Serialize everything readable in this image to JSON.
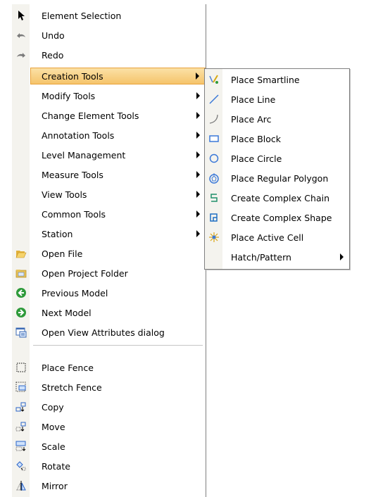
{
  "main_menu": {
    "items": [
      {
        "label": "Element Selection",
        "icon": "arrow-cursor-icon"
      },
      {
        "label": "Undo",
        "icon": "undo-icon"
      },
      {
        "label": "Redo",
        "icon": "redo-icon"
      },
      {
        "label": "Creation Tools",
        "submenu": true,
        "highlighted": true
      },
      {
        "label": "Modify Tools",
        "submenu": true
      },
      {
        "label": "Change Element Tools",
        "submenu": true
      },
      {
        "label": "Annotation Tools",
        "submenu": true
      },
      {
        "label": "Level Management",
        "submenu": true
      },
      {
        "label": "Measure Tools",
        "submenu": true
      },
      {
        "label": "View Tools",
        "submenu": true
      },
      {
        "label": "Common Tools",
        "submenu": true
      },
      {
        "label": "Station",
        "submenu": true
      },
      {
        "label": "Open File",
        "icon": "open-folder-icon"
      },
      {
        "label": "Open Project Folder",
        "icon": "project-folder-icon"
      },
      {
        "label": "Previous Model",
        "icon": "previous-model-icon"
      },
      {
        "label": "Next Model",
        "icon": "next-model-icon"
      },
      {
        "label": "Open View Attributes dialog",
        "icon": "view-attributes-icon"
      },
      {
        "label": "Place Fence",
        "icon": "place-fence-icon"
      },
      {
        "label": "Stretch Fence",
        "icon": "stretch-fence-icon"
      },
      {
        "label": "Copy",
        "icon": "copy-icon"
      },
      {
        "label": "Move",
        "icon": "move-icon"
      },
      {
        "label": "Scale",
        "icon": "scale-icon"
      },
      {
        "label": "Rotate",
        "icon": "rotate-icon"
      },
      {
        "label": "Mirror",
        "icon": "mirror-icon"
      }
    ]
  },
  "creation_tools_menu": {
    "items": [
      {
        "label": "Place Smartline",
        "icon": "smartline-icon"
      },
      {
        "label": "Place Line",
        "icon": "line-icon"
      },
      {
        "label": "Place Arc",
        "icon": "arc-icon"
      },
      {
        "label": "Place Block",
        "icon": "block-icon"
      },
      {
        "label": "Place Circle",
        "icon": "circle-icon"
      },
      {
        "label": "Place Regular Polygon",
        "icon": "regular-polygon-icon"
      },
      {
        "label": "Create Complex Chain",
        "icon": "complex-chain-icon"
      },
      {
        "label": "Create Complex Shape",
        "icon": "complex-shape-icon"
      },
      {
        "label": "Place Active Cell",
        "icon": "active-cell-icon"
      },
      {
        "label": "Hatch/Pattern",
        "submenu": true
      }
    ]
  }
}
